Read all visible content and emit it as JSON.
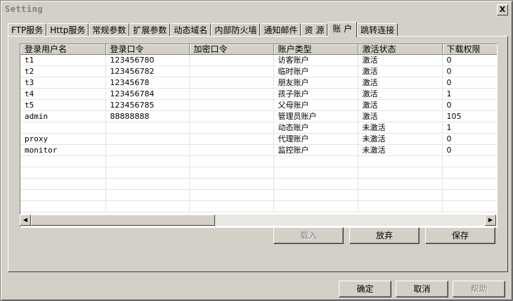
{
  "window": {
    "title": "Setting",
    "close_label": "X"
  },
  "tabs": [
    {
      "label": "FTP服务"
    },
    {
      "label": "Http服务"
    },
    {
      "label": "常规参数"
    },
    {
      "label": "扩展参数"
    },
    {
      "label": "动态域名"
    },
    {
      "label": "内部防火墙"
    },
    {
      "label": "通知邮件"
    },
    {
      "label": "资 源"
    },
    {
      "label": "账 户",
      "active": true
    },
    {
      "label": "跳转连接"
    }
  ],
  "grid": {
    "columns": [
      "登录用户名",
      "登录口令",
      "加密口令",
      "账户类型",
      "激活状态",
      "下载权限"
    ],
    "rows": [
      [
        "t1",
        "123456780",
        "",
        "访客账户",
        "激活",
        "0"
      ],
      [
        "t2",
        "123456782",
        "",
        "临时账户",
        "激活",
        "0"
      ],
      [
        "t3",
        "12345678",
        "",
        "朋友账户",
        "激活",
        "0"
      ],
      [
        "t4",
        "123456784",
        "",
        "孩子账户",
        "激活",
        "1"
      ],
      [
        "t5",
        "123456785",
        "",
        "父母账户",
        "激活",
        "0"
      ],
      [
        "admin",
        "88888888",
        "",
        "管理员账户",
        "激活",
        "105"
      ],
      [
        "",
        "",
        "",
        "动态账户",
        "未激活",
        "1"
      ],
      [
        "proxy",
        "",
        "",
        "代理账户",
        "未激活",
        "0"
      ],
      [
        "monitor",
        "",
        "",
        "监控账户",
        "未激活",
        "0"
      ],
      [
        "",
        "",
        "",
        "",
        "",
        ""
      ],
      [
        "",
        "",
        "",
        "",
        "",
        ""
      ],
      [
        "",
        "",
        "",
        "",
        "",
        ""
      ],
      [
        "",
        "",
        "",
        "",
        "",
        ""
      ],
      [
        "",
        "",
        "",
        "",
        "",
        ""
      ]
    ]
  },
  "panel_buttons": {
    "load": "载入",
    "discard": "放弃",
    "save": "保存"
  },
  "footer_buttons": {
    "ok": "确定",
    "cancel": "取消",
    "help": "帮助"
  }
}
